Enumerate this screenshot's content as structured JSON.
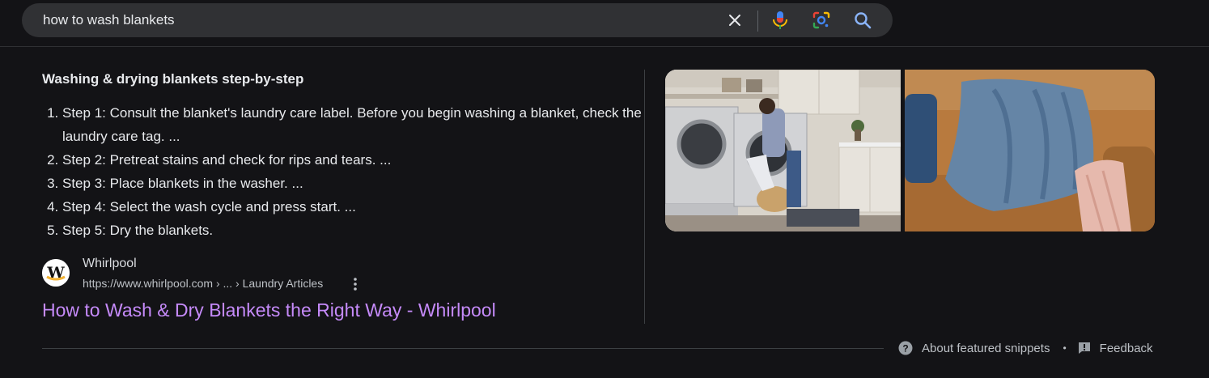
{
  "search": {
    "query": "how to wash blankets"
  },
  "icons": {
    "clear": "close-icon",
    "voice": "mic-icon",
    "lens": "lens-icon",
    "search": "search-icon"
  },
  "snippet": {
    "title": "Washing & drying blankets step-by-step",
    "steps": [
      "Step 1: Consult the blanket's laundry care label. Before you begin washing a blanket, check the laundry care tag. ...",
      "Step 2: Pretreat stains and check for rips and tears. ...",
      "Step 3: Place blankets in the washer. ...",
      "Step 4: Select the wash cycle and press start. ...",
      "Step 5: Dry the blankets."
    ]
  },
  "source": {
    "name": "Whirlpool",
    "url": "https://www.whirlpool.com › ... › Laundry Articles",
    "favicon_letter": "W"
  },
  "result": {
    "title": "How to Wash & Dry Blankets the Right Way - Whirlpool"
  },
  "footer": {
    "about": "About featured snippets",
    "separator": "•",
    "feedback": "Feedback"
  },
  "colors": {
    "background": "#131316",
    "link": "#c58af9",
    "searchbox": "#303134"
  }
}
